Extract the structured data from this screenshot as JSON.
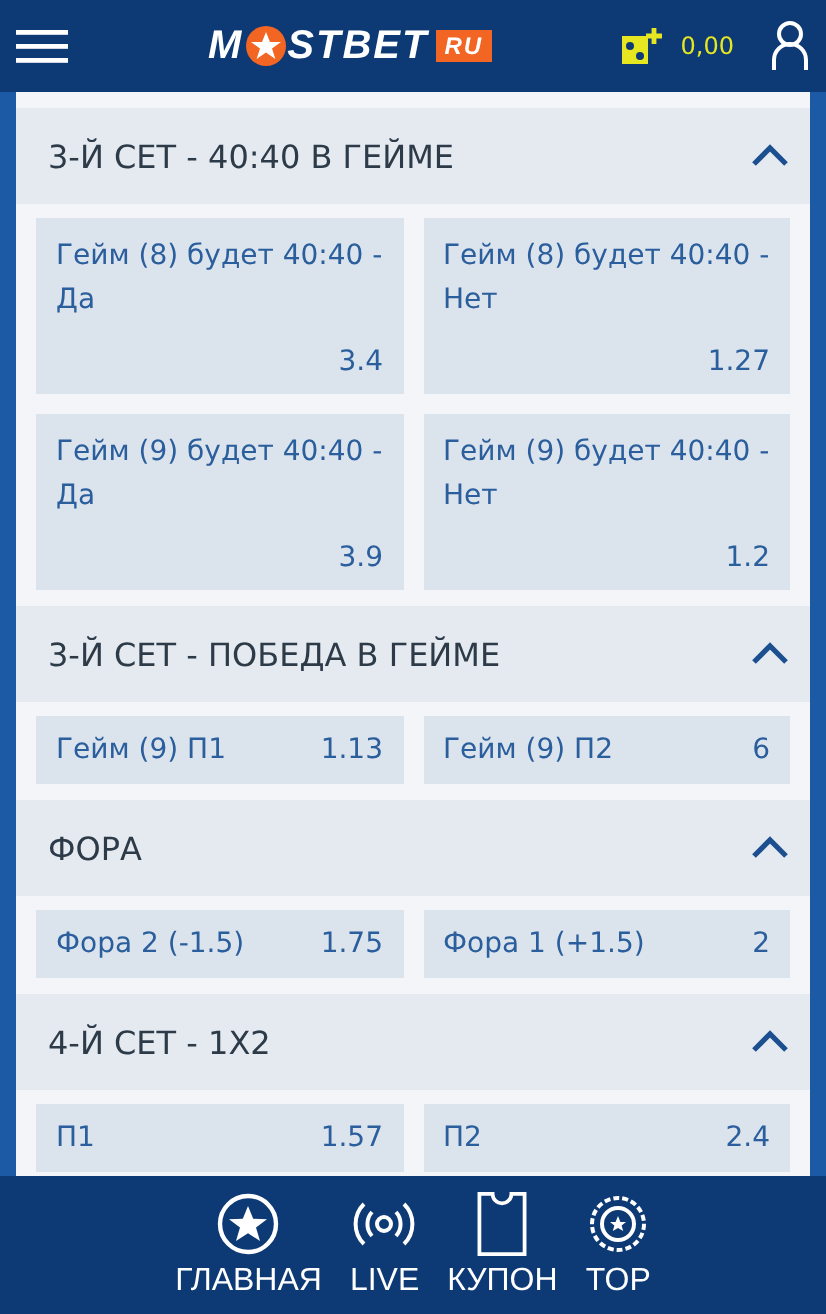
{
  "header": {
    "logo": {
      "left": "M",
      "right": "STBET",
      "badge": "RU"
    },
    "balance": "0,00"
  },
  "sections": [
    {
      "title": "3-Й СЕТ - 40:40 В ГЕЙМЕ",
      "expanded": true,
      "kind": "tall",
      "outcomes": [
        {
          "label": "Гейм (8) будет 40:40 - Да",
          "odds": "3.4"
        },
        {
          "label": "Гейм (8) будет 40:40 - Нет",
          "odds": "1.27"
        },
        {
          "label": "Гейм (9) будет 40:40 - Да",
          "odds": "3.9"
        },
        {
          "label": "Гейм (9) будет 40:40 - Нет",
          "odds": "1.2"
        }
      ]
    },
    {
      "title": "3-Й СЕТ - ПОБЕДА В ГЕЙМЕ",
      "expanded": true,
      "kind": "inline",
      "outcomes": [
        {
          "label": "Гейм (9) П1",
          "odds": "1.13"
        },
        {
          "label": "Гейм (9) П2",
          "odds": "6"
        }
      ]
    },
    {
      "title": "ФОРА",
      "expanded": true,
      "kind": "inline",
      "outcomes": [
        {
          "label": "Фора 2 (-1.5)",
          "odds": "1.75"
        },
        {
          "label": "Фора 1 (+1.5)",
          "odds": "2"
        }
      ]
    },
    {
      "title": "4-Й СЕТ - 1X2",
      "expanded": true,
      "kind": "inline",
      "outcomes": [
        {
          "label": "П1",
          "odds": "1.57"
        },
        {
          "label": "П2",
          "odds": "2.4"
        }
      ]
    }
  ],
  "nav": [
    {
      "label": "ГЛАВНАЯ",
      "kind": "star"
    },
    {
      "label": "LIVE",
      "kind": "live"
    },
    {
      "label": "КУПОН",
      "kind": "coupon"
    },
    {
      "label": "TOP",
      "kind": "top"
    }
  ]
}
